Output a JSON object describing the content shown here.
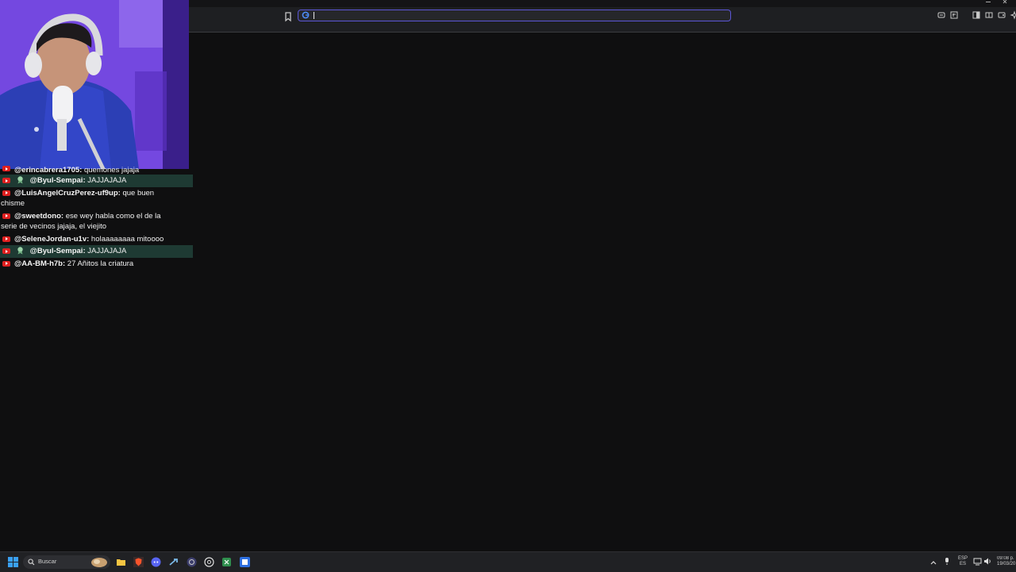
{
  "browser": {
    "address_placeholder": ""
  },
  "chat": {
    "messages": [
      {
        "author": "@erincabrera1705:",
        "text": "quemones jajaja",
        "highlight": false
      },
      {
        "author": "@Byul-Sempai:",
        "text": "JAJJAJAJA",
        "highlight": true
      },
      {
        "author": "@LuisAngelCruzPerez-uf9up:",
        "text": "que buen",
        "wrap": "chisme",
        "highlight": false
      },
      {
        "author": "@sweetdono:",
        "text": "ese wey habla como el de la",
        "wrap": "serie de vecinos jajaja, el viejito",
        "highlight": false
      },
      {
        "author": "@SeleneJordan-u1v:",
        "text": "holaaaaaaaa mitoooo",
        "highlight": false
      },
      {
        "author": "@Byul-Sempai:",
        "text": "JAJJAJAJA",
        "highlight": true
      },
      {
        "author": "@AA-BM-h7b:",
        "text": "27 Añitos la criatura",
        "highlight": false
      }
    ]
  },
  "taskbar": {
    "search_label": "Buscar",
    "lang_top": "ESP",
    "lang_bottom": "ES",
    "time": "09:08 p.",
    "date": "19/03/20"
  },
  "colors": {
    "accent": "#5b56d6",
    "chat_highlight": "#1e3a33",
    "youtube_red": "#e02020"
  }
}
